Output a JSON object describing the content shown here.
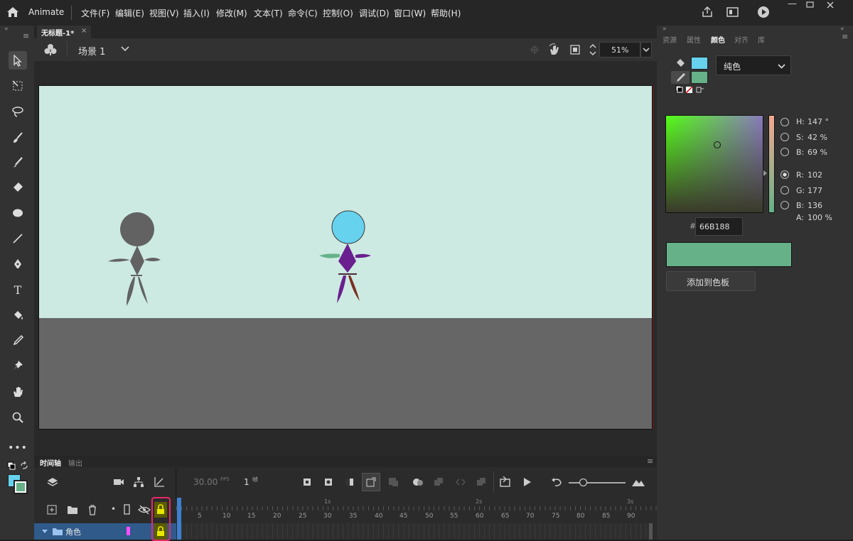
{
  "menubar": {
    "app_name": "Animate",
    "items": [
      "文件(F)",
      "编辑(E)",
      "视图(V)",
      "插入(I)",
      "修改(M)",
      "文本(T)",
      "命令(C)",
      "控制(O)",
      "调试(D)",
      "窗口(W)",
      "帮助(H)"
    ]
  },
  "document": {
    "tab_title": "无标题-1*",
    "tab_close": "×",
    "scene_label": "场景 1",
    "zoom": "51%"
  },
  "panel_tabs": [
    "资源",
    "属性",
    "颜色",
    "对齐",
    "库"
  ],
  "color_panel": {
    "fill_type": "纯色",
    "H": "147 °",
    "S": "42 %",
    "B": "69 %",
    "R": "102",
    "G": "177",
    "B2": "136",
    "A": "100 %",
    "hex_prefix": "#",
    "hex": "66B188",
    "add_swatch_label": "添加到色板",
    "labels": {
      "H": "H:",
      "S": "S:",
      "B": "B:",
      "R": "R:",
      "G": "G:",
      "B2": "B:",
      "A": "A:"
    },
    "stroke_color": "#66d2ee",
    "fill_color": "#66b188"
  },
  "timeline": {
    "tabs": [
      "时间轴",
      "输出"
    ],
    "fps": "30.00",
    "fps_unit": "FPS",
    "frame": "1",
    "frame_unit": "帧",
    "layer_name": "角色",
    "ruler": [
      "5",
      "10",
      "15",
      "20",
      "25",
      "30",
      "35",
      "40",
      "45",
      "50",
      "55",
      "60",
      "65",
      "70",
      "75",
      "80",
      "85",
      "90"
    ],
    "seconds": [
      "1s",
      "2s",
      "3s"
    ]
  }
}
